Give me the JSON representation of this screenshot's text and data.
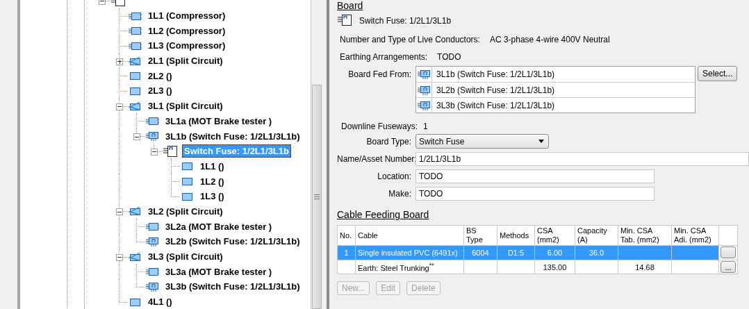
{
  "tree": {
    "nodes": [
      {
        "kind": "board-white",
        "expanded": true,
        "children": [
          {
            "label": "1L1 (Compressor)",
            "kind": "board",
            "selected": false
          },
          {
            "label": "1L2 (Compressor)",
            "kind": "board",
            "selected": false
          },
          {
            "label": "1L3 (Compressor)",
            "kind": "board",
            "selected": false
          },
          {
            "label": "2L1 (Split Circuit)",
            "kind": "split",
            "expanded": false,
            "selected": false
          },
          {
            "label": "2L2 ()",
            "kind": "circuit",
            "selected": false
          },
          {
            "label": "2L3 ()",
            "kind": "circuit",
            "selected": false
          },
          {
            "label": "3L1 (Split Circuit)",
            "kind": "split",
            "expanded": true,
            "selected": false,
            "children": [
              {
                "label": "3L1a (MOT Brake tester )",
                "kind": "board",
                "selected": false
              },
              {
                "label": "3L1b (Switch Fuse: 1/2L1/3L1b)",
                "kind": "switch-fuse",
                "expanded": true,
                "selected": false,
                "children": [
                  {
                    "label": "Switch Fuse: 1/2L1/3L1b",
                    "kind": "board-white",
                    "expanded": true,
                    "selected": true,
                    "children": [
                      {
                        "label": "1L1 ()",
                        "kind": "circuit",
                        "selected": false
                      },
                      {
                        "label": "1L2 ()",
                        "kind": "circuit",
                        "selected": false
                      },
                      {
                        "label": "1L3 ()",
                        "kind": "circuit",
                        "selected": false
                      }
                    ]
                  }
                ]
              }
            ]
          },
          {
            "label": "3L2 (Split Circuit)",
            "kind": "split",
            "expanded": true,
            "selected": false,
            "children": [
              {
                "label": "3L2a (MOT Brake tester )",
                "kind": "board",
                "selected": false
              },
              {
                "label": "3L2b (Switch Fuse: 1/2L1/3L1b)",
                "kind": "switch-fuse",
                "selected": false
              }
            ]
          },
          {
            "label": "3L3 (Split Circuit)",
            "kind": "split",
            "expanded": true,
            "selected": false,
            "children": [
              {
                "label": "3L3a (MOT Brake tester )",
                "kind": "board",
                "selected": false
              },
              {
                "label": "3L3b (Switch Fuse: 1/2L1/3L1b)",
                "kind": "switch-fuse",
                "selected": false
              }
            ]
          },
          {
            "label": "4L1 ()",
            "kind": "circuit",
            "selected": false
          }
        ]
      }
    ]
  },
  "board": {
    "heading": "Board",
    "title": "Switch Fuse: 1/2L1/3L1b",
    "live_conductors": {
      "label": "Number and Type of Live Conductors:",
      "value": "AC 3-phase 4-wire 400V Neutral"
    },
    "earthing": {
      "label": "Earthing Arrangements:",
      "value": "TODO"
    },
    "fed_from": {
      "label": "Board Fed From:",
      "button": "Select...",
      "items": [
        "3L1b (Switch Fuse: 1/2L1/3L1b)",
        "3L2b (Switch Fuse: 1/2L1/3L1b)",
        "3L3b (Switch Fuse: 1/2L1/3L1b)"
      ]
    },
    "downline": {
      "label": "Downline Fuseways:",
      "value": "1"
    },
    "board_type": {
      "label": "Board Type:",
      "value": "Switch Fuse"
    },
    "name": {
      "label": "Name/Asset Number:",
      "value": "1/2L1/3L1b"
    },
    "location": {
      "label": "Location:",
      "value": "TODO"
    },
    "make": {
      "label": "Make:",
      "value": "TODO"
    }
  },
  "cable": {
    "heading": "Cable Feeding Board",
    "columns": [
      "No.",
      "Cable",
      "BS\nType",
      "Methods",
      "CSA\n(mm2)",
      "Capacity\n(A)",
      "Min. CSA\nTab. (mm2)",
      "Min. CSA\nAdi. (mm2)"
    ],
    "rows": [
      {
        "selected": true,
        "cells": [
          "1",
          "Single insulated PVC (6491x)",
          "6004",
          "D1:5",
          "6.00",
          "36.0",
          null,
          null
        ]
      },
      {
        "selected": false,
        "cells": [
          null,
          "Earth: Steel Trunking$^{**}$",
          null,
          null,
          "135.00",
          null,
          "14.68",
          null
        ],
        "button": "..."
      }
    ]
  },
  "actions": [
    {
      "label": "New...",
      "disabled": true
    },
    {
      "label": "Edit",
      "disabled": true
    },
    {
      "label": "Delete",
      "disabled": true
    }
  ]
}
